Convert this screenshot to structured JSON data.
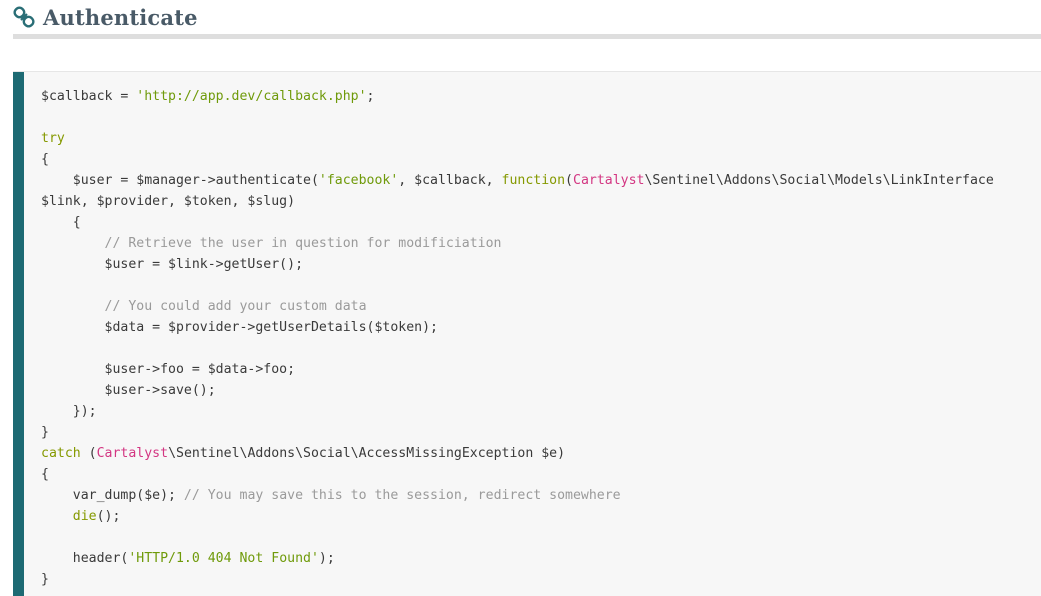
{
  "section": {
    "title": "Authenticate",
    "icon": "link-icon"
  },
  "code": {
    "language": "php",
    "lines": [
      [
        {
          "t": "p",
          "v": "$callback = "
        },
        {
          "t": "s",
          "v": "'http://app.dev/callback.php'"
        },
        {
          "t": "p",
          "v": ";"
        }
      ],
      [],
      [
        {
          "t": "k",
          "v": "try"
        }
      ],
      [
        {
          "t": "p",
          "v": "{"
        }
      ],
      [
        {
          "t": "p",
          "v": "    $user = $manager->authenticate("
        },
        {
          "t": "s",
          "v": "'facebook'"
        },
        {
          "t": "p",
          "v": ", $callback, "
        },
        {
          "t": "k",
          "v": "function"
        },
        {
          "t": "p",
          "v": "("
        },
        {
          "t": "n",
          "v": "Cartalyst"
        },
        {
          "t": "p",
          "v": "\\Sentinel\\Addons\\Social\\Models\\LinkInterface"
        }
      ],
      [
        {
          "t": "p",
          "v": "$link, $provider, $token, $slug)"
        }
      ],
      [
        {
          "t": "p",
          "v": "    {"
        }
      ],
      [
        {
          "t": "c",
          "v": "        // Retrieve the user in question for modificiation"
        }
      ],
      [
        {
          "t": "p",
          "v": "        $user = $link->getUser();"
        }
      ],
      [],
      [
        {
          "t": "c",
          "v": "        // You could add your custom data"
        }
      ],
      [
        {
          "t": "p",
          "v": "        $data = $provider->getUserDetails($token);"
        }
      ],
      [],
      [
        {
          "t": "p",
          "v": "        $user->foo = $data->foo;"
        }
      ],
      [
        {
          "t": "p",
          "v": "        $user->save();"
        }
      ],
      [
        {
          "t": "p",
          "v": "    });"
        }
      ],
      [
        {
          "t": "p",
          "v": "}"
        }
      ],
      [
        {
          "t": "k",
          "v": "catch"
        },
        {
          "t": "p",
          "v": " ("
        },
        {
          "t": "n",
          "v": "Cartalyst"
        },
        {
          "t": "p",
          "v": "\\Sentinel\\Addons\\Social\\AccessMissingException $e)"
        }
      ],
      [
        {
          "t": "p",
          "v": "{"
        }
      ],
      [
        {
          "t": "p",
          "v": "    var_dump($e); "
        },
        {
          "t": "c",
          "v": "// You may save this to the session, redirect somewhere"
        }
      ],
      [
        {
          "t": "p",
          "v": "    "
        },
        {
          "t": "k",
          "v": "die"
        },
        {
          "t": "p",
          "v": "();"
        }
      ],
      [],
      [
        {
          "t": "p",
          "v": "    header("
        },
        {
          "t": "s",
          "v": "'HTTP/1.0 404 Not Found'"
        },
        {
          "t": "p",
          "v": ");"
        }
      ],
      [
        {
          "t": "p",
          "v": "}"
        }
      ]
    ]
  },
  "colors": {
    "accent_bar": "#1d6a73",
    "heading": "#495a67",
    "keyword": "#859900",
    "string": "#6f9a0a",
    "comment": "#9a9a9a",
    "namespace": "#d33682"
  }
}
